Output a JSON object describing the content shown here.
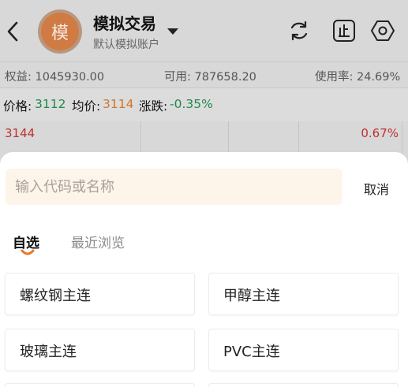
{
  "header": {
    "avatar_char": "模",
    "title": "模拟交易",
    "subtitle": "默认模拟账户"
  },
  "stats": {
    "equity": "权益: 1045930.00",
    "available": "可用: 787658.20",
    "usage": "使用率: 24.69%"
  },
  "price_bar": {
    "price_label": "价格:",
    "price_value": "3112",
    "avg_label": "均价:",
    "avg_value": "3114",
    "change_label": "涨跌:",
    "change_value": "-0.35%"
  },
  "grid": {
    "left_value": "3144",
    "right_value": "0.67%"
  },
  "search": {
    "placeholder": "输入代码或名称",
    "value": "",
    "cancel_label": "取消"
  },
  "tabs": [
    {
      "label": "自选",
      "active": true
    },
    {
      "label": "最近浏览",
      "active": false
    }
  ],
  "cards": [
    {
      "label": "螺纹钢主连"
    },
    {
      "label": "甲醇主连"
    },
    {
      "label": "玻璃主连"
    },
    {
      "label": "PVC主连"
    }
  ],
  "colors": {
    "up_green": "#1f8a4c",
    "accent_orange": "#d2752a",
    "down_red": "#c03030",
    "search_bg": "#fdf4ea"
  },
  "icons": {
    "back": "chevron-left-icon",
    "refresh": "refresh-icon",
    "stop": "stop-order-icon",
    "settings": "settings-hexagon-icon",
    "dropdown": "caret-down-icon"
  }
}
